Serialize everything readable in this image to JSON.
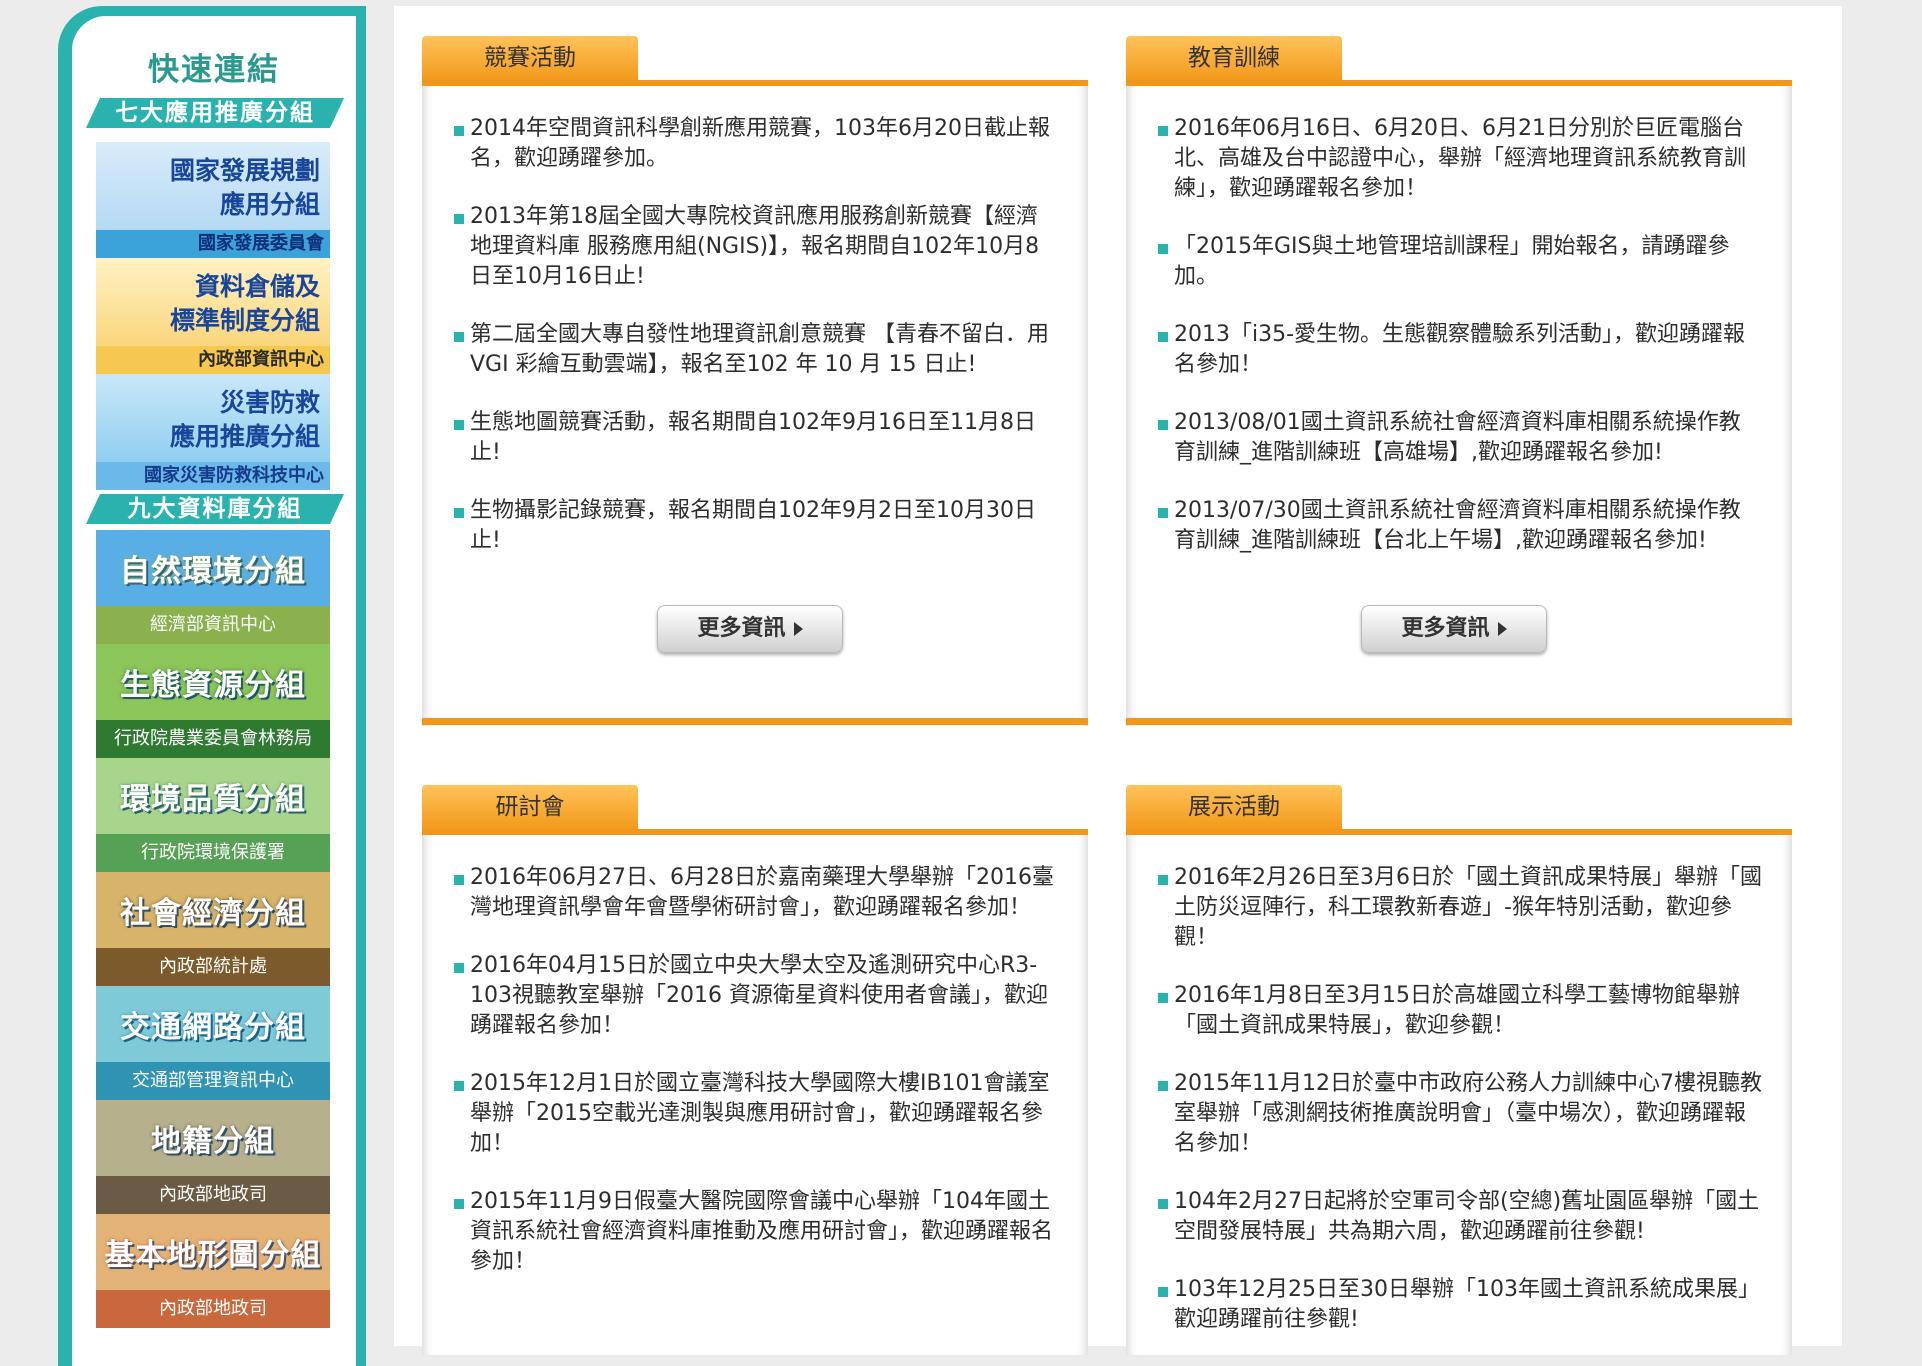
{
  "sidebar": {
    "title": "快速連結",
    "group_apps": "七大應用推廣分組",
    "group_db": "九大資料庫分組",
    "app_tiles": [
      {
        "line1": "國家發展規劃",
        "line2": "應用分組",
        "org": "國家發展委員會"
      },
      {
        "line1": "資料倉儲及",
        "line2": "標準制度分組",
        "org": "內政部資訊中心"
      },
      {
        "line1": "災害防救",
        "line2": "應用推廣分組",
        "org": "國家災害防救科技中心"
      }
    ],
    "db_tiles": [
      {
        "name": "自然環境分組",
        "agency": "經濟部資訊中心",
        "color_top": "#5aaee6",
        "color_bottom": "#8ab14e"
      },
      {
        "name": "生態資源分組",
        "agency": "行政院農業委員會林務局",
        "color_top": "#8cc55a",
        "color_bottom": "#2f7a31"
      },
      {
        "name": "環境品質分組",
        "agency": "行政院環境保護署",
        "color_top": "#a9d48c",
        "color_bottom": "#55a155"
      },
      {
        "name": "社會經濟分組",
        "agency": "內政部統計處",
        "color_top": "#d7b46a",
        "color_bottom": "#7c5a2c"
      },
      {
        "name": "交通網路分組",
        "agency": "交通部管理資訊中心",
        "color_top": "#7fcad8",
        "color_bottom": "#2f93b4"
      },
      {
        "name": "地籍分組",
        "agency": "內政部地政司",
        "color_top": "#b6b08c",
        "color_bottom": "#6b5b45"
      },
      {
        "name": "基本地形圖分組",
        "agency": "內政部地政司",
        "color_top": "#e3b277",
        "color_bottom": "#c9683c"
      }
    ]
  },
  "panels": {
    "competition": {
      "title": "競賽活動",
      "more": "更多資訊",
      "items": [
        "2014年空間資訊科學創新應用競賽，103年6月20日截止報名，歡迎踴躍參加。",
        "2013年第18屆全國大專院校資訊應用服務創新競賽【經濟地理資料庫 服務應用組(NGIS)】，報名期間自102年10月8日至10月16日止!",
        "第二屆全國大專自發性地理資訊創意競賽 【青春不留白．用 VGI 彩繪互動雲端】，報名至102 年 10 月 15 日止!",
        "生態地圖競賽活動，報名期間自102年9月16日至11月8日止!",
        "生物攝影記錄競賽，報名期間自102年9月2日至10月30日止!"
      ]
    },
    "training": {
      "title": "教育訓練",
      "more": "更多資訊",
      "items": [
        "2016年06月16日、6月20日、6月21日分別於巨匠電腦台北、高雄及台中認證中心，舉辦「經濟地理資訊系統教育訓練」，歡迎踴躍報名參加！",
        "「2015年GIS與土地管理培訓課程」開始報名，請踴躍參加。",
        "2013「i35-愛生物。生態觀察體驗系列活動」，歡迎踴躍報名參加！",
        "2013/08/01國土資訊系統社會經濟資料庫相關系統操作教育訓練_進階訓練班【高雄場】,歡迎踴躍報名參加!",
        "2013/07/30國土資訊系統社會經濟資料庫相關系統操作教育訓練_進階訓練班【台北上午場】,歡迎踴躍報名參加!"
      ]
    },
    "seminar": {
      "title": "研討會",
      "items": [
        "2016年06月27日、6月28日於嘉南藥理大學舉辦「2016臺灣地理資訊學會年會暨學術研討會」，歡迎踴躍報名參加！",
        "2016年04月15日於國立中央大學太空及遙測研究中心R3-103視聽教室舉辦「2016 資源衛星資料使用者會議」，歡迎踴躍報名參加！",
        "2015年12月1日於國立臺灣科技大學國際大樓IB101會議室舉辦「2015空載光達測製與應用研討會」，歡迎踴躍報名參加！",
        "2015年11月9日假臺大醫院國際會議中心舉辦「104年國土資訊系統社會經濟資料庫推動及應用研討會」，歡迎踴躍報名參加！"
      ]
    },
    "exhibition": {
      "title": "展示活動",
      "items": [
        "2016年2月26日至3月6日於「國土資訊成果特展」舉辦「國土防災逗陣行，科工環教新春遊」-猴年特別活動，歡迎參觀！",
        "2016年1月8日至3月15日於高雄國立科學工藝博物館舉辦「國土資訊成果特展」，歡迎參觀！",
        "2015年11月12日於臺中市政府公務人力訓練中心7樓視聽教室舉辦「感測網技術推廣說明會」（臺中場次），歡迎踴躍報名參加！",
        "104年2月27日起將於空軍司令部(空總)舊址園區舉辦「國土空間發展特展」共為期六周，歡迎踴躍前往參觀!",
        "103年12月25日至30日舉辦「103年國土資訊系統成果展」歡迎踴躍前往參觀!"
      ]
    }
  }
}
